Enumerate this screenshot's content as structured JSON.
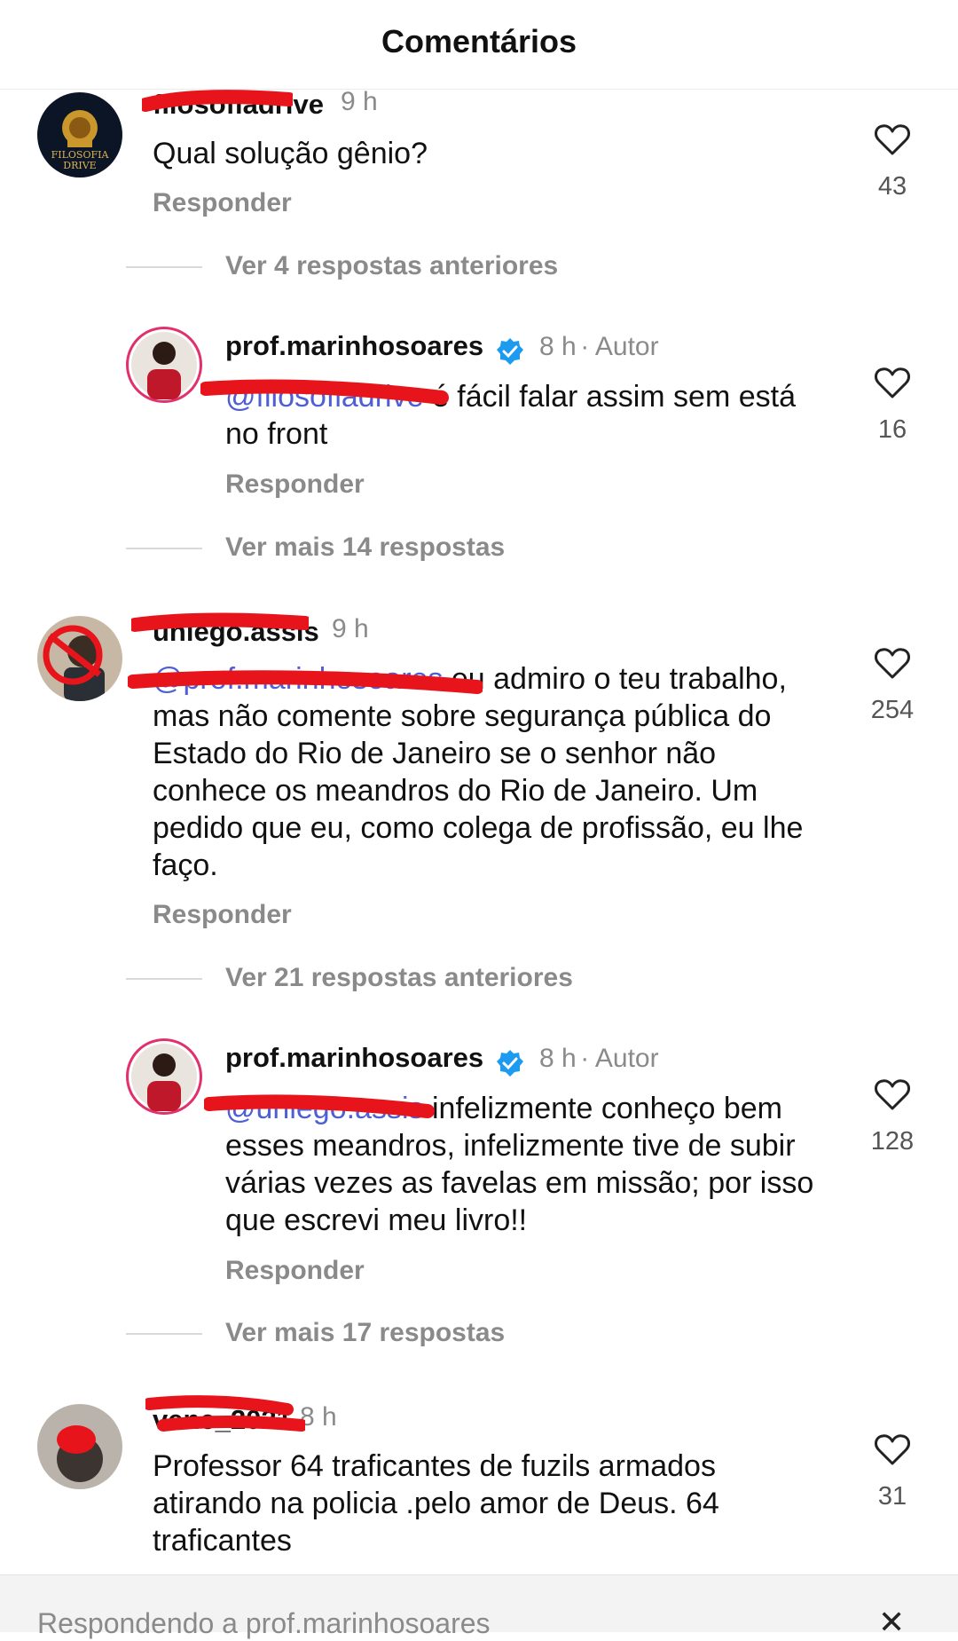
{
  "header": {
    "title": "Comentários"
  },
  "comments": [
    {
      "username": "filosofiadrive",
      "time": "9 h",
      "text": "Qual solução gênio?",
      "reply_label": "Responder",
      "likes": "43",
      "avatar_text_1": "FILOSOFIA",
      "avatar_text_2": "DRIVE"
    },
    {
      "username": "uniego.assis",
      "time": "9 h",
      "mention": "@prof.marinhosoares",
      "text": " eu admiro o teu trabalho, mas não comente sobre segurança pública do Estado do Rio de Janeiro se o senhor não conhece os meandros do Rio de Janeiro. Um pedido que eu, como colega de profissão, eu lhe faço.",
      "reply_label": "Responder",
      "likes": "254"
    },
    {
      "username": "vene_2021",
      "time": "8 h",
      "text": "Professor 64 traficantes de fuzils armados atirando na policia .pelo amor de Deus. 64 traficantes",
      "likes": "31"
    }
  ],
  "replies": [
    {
      "username": "prof.marinhosoares",
      "time": "8 h",
      "author_label": "Autor",
      "mention": "@filosofiadrive",
      "text": " é fácil falar assim sem está no front",
      "reply_label": "Responder",
      "likes": "16"
    },
    {
      "username": "prof.marinhosoares",
      "time": "8 h",
      "author_label": "Autor",
      "mention": "@uniego.assis",
      "text": " infelizmente conheço bem esses meandros, infelizmente tive de subir várias vezes as favelas em missão; por isso que escrevi meu livro!!",
      "reply_label": "Responder",
      "likes": "128"
    }
  ],
  "threads": {
    "view_previous_1": "Ver 4 respostas anteriores",
    "view_more_1": "Ver mais 14 respostas",
    "view_previous_2": "Ver 21 respostas anteriores",
    "view_more_2": "Ver mais 17 respostas"
  },
  "footer": {
    "replying_to": "Respondendo a prof.marinhosoares"
  },
  "colors": {
    "mention": "#4e5fd6",
    "verified": "#1d9bf0",
    "redaction": "#e8141b"
  }
}
